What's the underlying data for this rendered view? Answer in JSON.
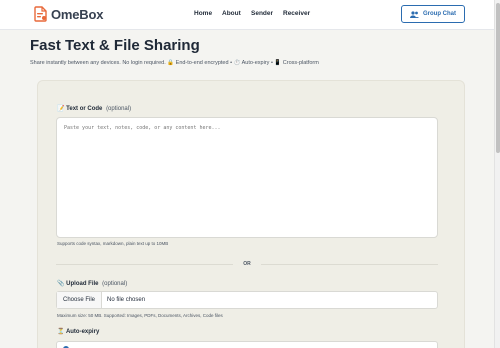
{
  "brand": {
    "name": "OmeBox"
  },
  "nav": {
    "links": [
      "Home",
      "About",
      "Sender",
      "Receiver"
    ],
    "group_chat": "Group Chat"
  },
  "page": {
    "title": "Fast Text & File Sharing",
    "subtitle": "Share instantly between any devices. No login required. 🔒 End-to-end encrypted • ⏱️ Auto-expiry • 📱 Cross-platform"
  },
  "text_section": {
    "icon": "📝",
    "label": "Text or Code",
    "optional": "(optional)",
    "placeholder": "Paste your text, notes, code, or any content here...",
    "help": "Supports code syntax, markdown, plain text up to 10MB"
  },
  "divider": {
    "label": "OR"
  },
  "upload_section": {
    "icon": "📎",
    "label": "Upload File",
    "optional": "(optional)",
    "choose_button": "Choose File",
    "no_file": "No file chosen",
    "help": "Maximum size: 50 MB. Supported: Images, PDFs, Documents, Archives, Code files"
  },
  "expiry_section": {
    "icon": "⏳",
    "label": "Auto-expiry"
  },
  "colors": {
    "accent": "#2b6cb0",
    "brand_orange": "#e8693a",
    "background": "#f4f4f1",
    "card": "#efeee6"
  }
}
